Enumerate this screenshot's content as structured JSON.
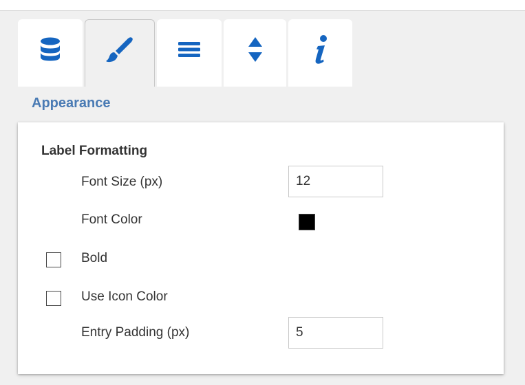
{
  "tabs": [
    {
      "icon": "database-icon",
      "active": false
    },
    {
      "icon": "paintbrush-icon",
      "active": true
    },
    {
      "icon": "menu-lines-icon",
      "active": false
    },
    {
      "icon": "sort-arrows-icon",
      "active": false
    },
    {
      "icon": "info-icon",
      "active": false
    }
  ],
  "section": {
    "title": "Appearance"
  },
  "label_formatting": {
    "title": "Label Formatting",
    "font_size": {
      "label": "Font Size (px)",
      "value": "12"
    },
    "font_color": {
      "label": "Font Color",
      "value": "#000000"
    },
    "bold": {
      "label": "Bold",
      "checked": false
    },
    "use_icon_color": {
      "label": "Use Icon Color",
      "checked": false
    },
    "entry_padding": {
      "label": "Entry Padding (px)",
      "value": "5"
    }
  },
  "colors": {
    "accent": "#1565c0",
    "title": "#4a7bb4"
  }
}
